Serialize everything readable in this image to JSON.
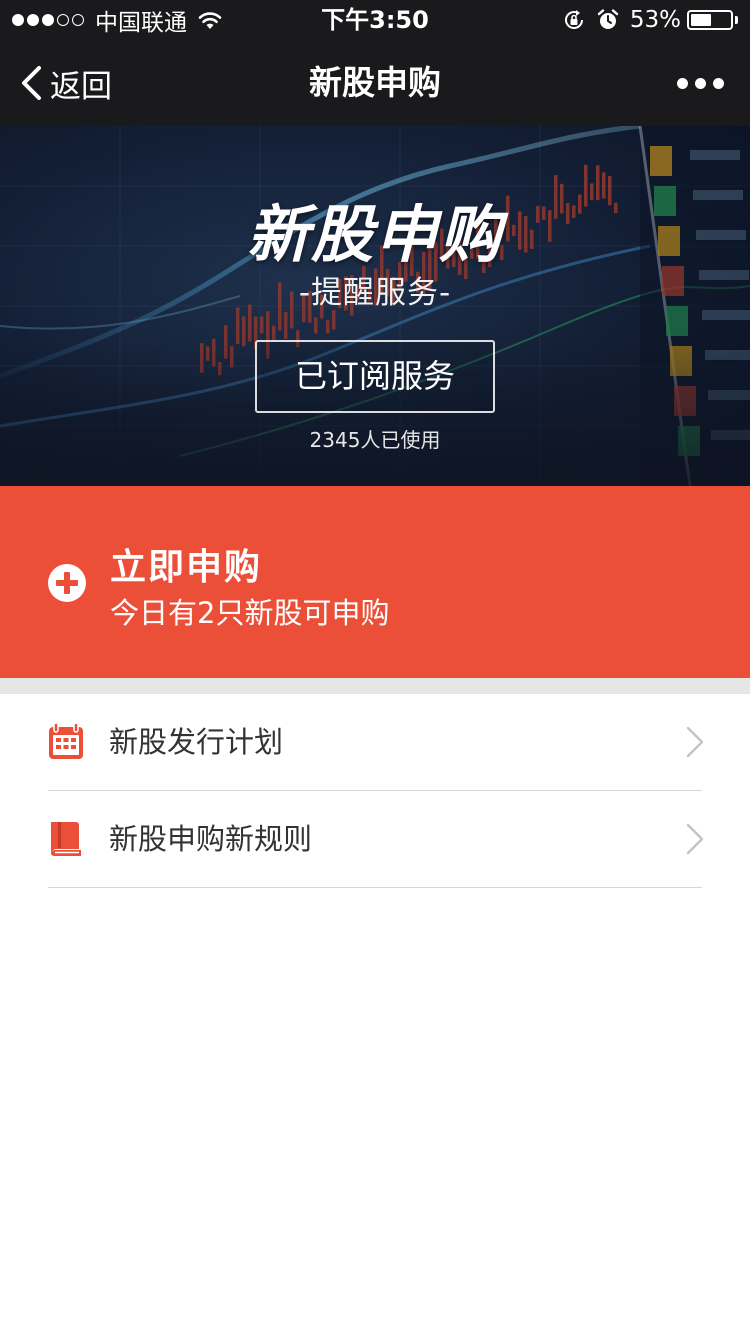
{
  "status_bar": {
    "carrier": "中国联通",
    "time": "下午3:50",
    "battery_percent": "53%",
    "battery_level": 0.53,
    "signal_strength": 3,
    "signal_max": 5
  },
  "nav": {
    "back_label": "返回",
    "title": "新股申购"
  },
  "hero": {
    "title": "新股申购",
    "subtitle": "-提醒服务-",
    "subscribe_button": "已订阅服务",
    "usage_count": "2345人已使用"
  },
  "cta": {
    "title": "立即申购",
    "subtitle": "今日有2只新股可申购",
    "color": "#ec4f38"
  },
  "list": {
    "items": [
      {
        "label": "新股发行计划",
        "icon": "calendar-icon"
      },
      {
        "label": "新股申购新规则",
        "icon": "book-icon"
      }
    ]
  },
  "colors": {
    "bar_background": "#1a1a1c",
    "accent_red": "#ec4f38",
    "text_dark": "#333333"
  }
}
